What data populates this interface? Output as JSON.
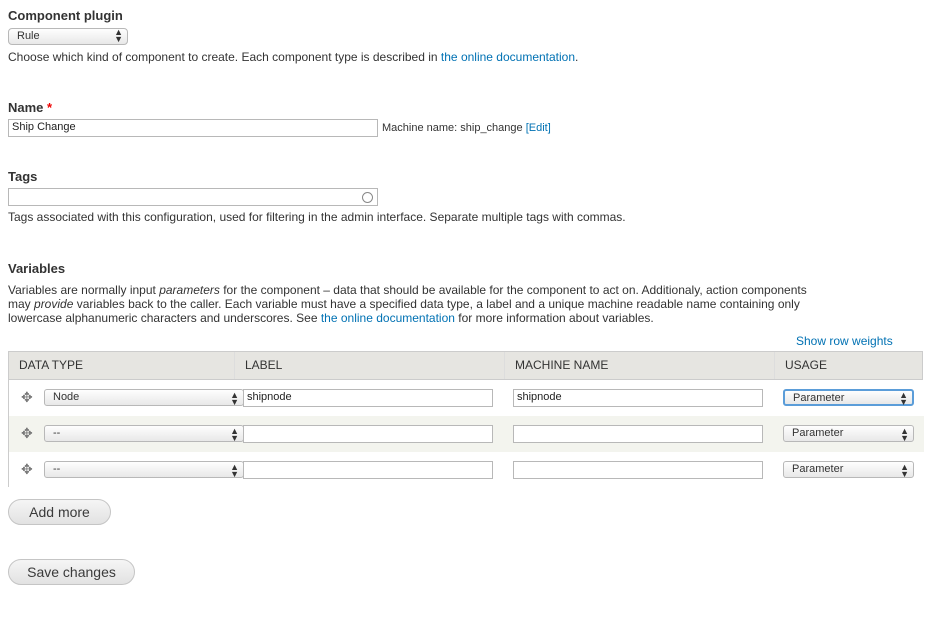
{
  "component_plugin": {
    "label": "Component plugin",
    "selected": "Rule",
    "description_prefix": "Choose which kind of component to create. Each component type is described in ",
    "description_link": "the online documentation",
    "description_suffix": "."
  },
  "name": {
    "label": "Name",
    "required_mark": "*",
    "value": "Ship Change",
    "machine_prefix": "Machine name: ship_change ",
    "machine_edit": "[Edit]"
  },
  "tags": {
    "label": "Tags",
    "value": "",
    "description": "Tags associated with this configuration, used for filtering in the admin interface. Separate multiple tags with commas."
  },
  "variables": {
    "label": "Variables",
    "desc_1a": "Variables are normally input ",
    "desc_1b": "parameters",
    "desc_1c": " for the component – data that should be available for the component to act on. Additionaly, action components",
    "desc_2a": "may ",
    "desc_2b": "provide",
    "desc_2c": " variables back to the caller. Each variable must have a specified data type, a label and a unique machine readable name containing only",
    "desc_3a": "lowercase alphanumeric characters and underscores. See ",
    "desc_3b": "the online documentation",
    "desc_3c": " for more information about variables.",
    "show_row_weights": "Show row weights",
    "columns": [
      "DATA TYPE",
      "LABEL",
      "MACHINE NAME",
      "USAGE"
    ],
    "rows": [
      {
        "data_type": "Node",
        "label": "shipnode",
        "machine_name": "shipnode",
        "usage": "Parameter"
      },
      {
        "data_type": "--",
        "label": "",
        "machine_name": "",
        "usage": "Parameter"
      },
      {
        "data_type": "--",
        "label": "",
        "machine_name": "",
        "usage": "Parameter"
      }
    ]
  },
  "buttons": {
    "add_more": "Add more",
    "save_changes": "Save changes"
  }
}
